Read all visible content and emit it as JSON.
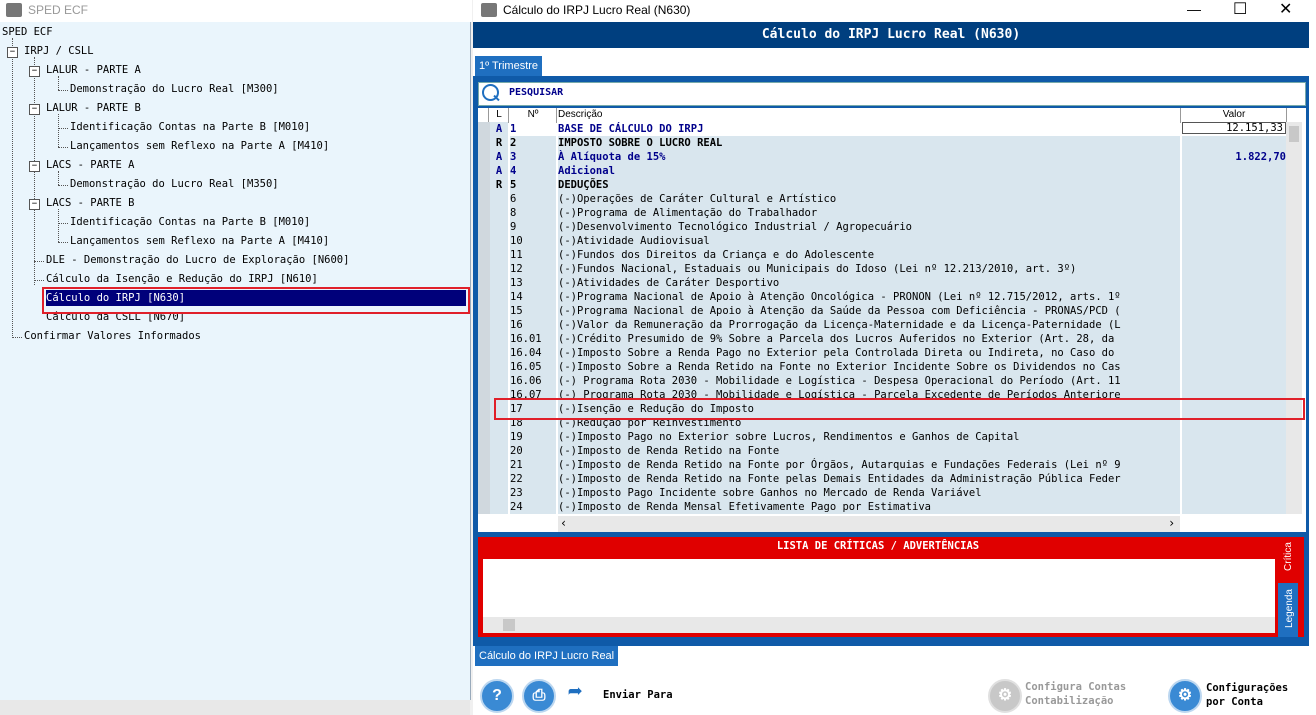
{
  "left_window": {
    "title": "SPED ECF",
    "tree": {
      "root": "SPED ECF",
      "irpj": "IRPJ / CSLL",
      "lalur_a": "LALUR - PARTE A",
      "lalur_a_1": "Demonstração do Lucro Real [M300]",
      "lalur_b": "LALUR - PARTE B",
      "lalur_b_1": "Identificação Contas na Parte B [M010]",
      "lalur_b_2": "Lançamentos sem Reflexo na Parte A [M410]",
      "lacs_a": "LACS - PARTE A",
      "lacs_a_1": "Demonstração do Lucro Real [M350]",
      "lacs_b": "LACS - PARTE B",
      "lacs_b_1": "Identificação Contas na Parte B [M010]",
      "lacs_b_2": "Lançamentos sem Reflexo na Parte A [M410]",
      "dle": "DLE - Demonstração do Lucro de Exploração [N600]",
      "isencao": "Cálculo da Isenção e Redução do IRPJ [N610]",
      "calc_irpj": "Cálculo do IRPJ [N630]",
      "calc_csll": "Cálculo da CSLL [N670]",
      "confirmar": "Confirmar Valores Informados"
    }
  },
  "right_window": {
    "title": "Cálculo do IRPJ Lucro Real (N630)",
    "header": "Cálculo do IRPJ Lucro Real (N630)",
    "tab": "1º Trimestre",
    "search_label": "PESQUISAR",
    "grid_headers": {
      "l": "L",
      "n": "Nº",
      "descricao": "Descrição",
      "valor": "Valor"
    },
    "rows": [
      {
        "flag": "A",
        "n": "1",
        "desc": "BASE DE CÁLCULO DO IRPJ",
        "valor": "12.151,33",
        "style": "bluebold",
        "input": true
      },
      {
        "flag": "R",
        "n": "2",
        "desc": "IMPOSTO SOBRE O LUCRO REAL",
        "valor": "",
        "style": "bold"
      },
      {
        "flag": "A",
        "n": "3",
        "desc": "À Alíquota de 15%",
        "valor": "1.822,70",
        "style": "bluebold"
      },
      {
        "flag": "A",
        "n": "4",
        "desc": "Adicional",
        "valor": "",
        "style": "bluebold"
      },
      {
        "flag": "R",
        "n": "5",
        "desc": "DEDUÇÕES",
        "valor": "",
        "style": "bold"
      },
      {
        "flag": "",
        "n": "6",
        "desc": "(-)Operações de Caráter Cultural e Artístico",
        "valor": ""
      },
      {
        "flag": "",
        "n": "8",
        "desc": "(-)Programa de Alimentação do Trabalhador",
        "valor": ""
      },
      {
        "flag": "",
        "n": "9",
        "desc": "(-)Desenvolvimento Tecnológico Industrial / Agropecuário",
        "valor": ""
      },
      {
        "flag": "",
        "n": "10",
        "desc": "(-)Atividade Audiovisual",
        "valor": ""
      },
      {
        "flag": "",
        "n": "11",
        "desc": "(-)Fundos dos Direitos da Criança e do Adolescente",
        "valor": ""
      },
      {
        "flag": "",
        "n": "12",
        "desc": "(-)Fundos Nacional, Estaduais ou Municipais do Idoso (Lei nº 12.213/2010, art. 3º)",
        "valor": ""
      },
      {
        "flag": "",
        "n": "13",
        "desc": "(-)Atividades de Caráter Desportivo",
        "valor": ""
      },
      {
        "flag": "",
        "n": "14",
        "desc": "(-)Programa Nacional de Apoio à Atenção Oncológica - PRONON (Lei nº 12.715/2012, arts. 1º",
        "valor": ""
      },
      {
        "flag": "",
        "n": "15",
        "desc": "(-)Programa Nacional de Apoio à Atenção da Saúde da Pessoa com Deficiência - PRONAS/PCD (",
        "valor": ""
      },
      {
        "flag": "",
        "n": "16",
        "desc": "(-)Valor da Remuneração da Prorrogação da Licença-Maternidade e da Licença-Paternidade (L",
        "valor": ""
      },
      {
        "flag": "",
        "n": "16.01",
        "desc": "(-)Crédito Presumido de 9% Sobre a Parcela dos Lucros Auferidos no Exterior (Art. 28, da",
        "valor": ""
      },
      {
        "flag": "",
        "n": "16.04",
        "desc": "(-)Imposto Sobre a Renda Pago no Exterior pela Controlada Direta ou Indireta, no Caso do",
        "valor": ""
      },
      {
        "flag": "",
        "n": "16.05",
        "desc": "(-)Imposto Sobre a Renda Retido na Fonte no Exterior Incidente Sobre os Dividendos no Cas",
        "valor": ""
      },
      {
        "flag": "",
        "n": "16.06",
        "desc": "(-) Programa Rota 2030 - Mobilidade e Logística - Despesa Operacional do Período (Art. 11",
        "valor": ""
      },
      {
        "flag": "",
        "n": "16.07",
        "desc": "(-) Programa Rota 2030 - Mobilidade e Logística - Parcela Excedente de Períodos Anteriore",
        "valor": ""
      },
      {
        "flag": "",
        "n": "17",
        "desc": "(-)Isenção e Redução do Imposto",
        "valor": ""
      },
      {
        "flag": "",
        "n": "18",
        "desc": "(-)Redução por Reinvestimento",
        "valor": ""
      },
      {
        "flag": "",
        "n": "19",
        "desc": "(-)Imposto Pago no Exterior sobre Lucros, Rendimentos e Ganhos de Capital",
        "valor": ""
      },
      {
        "flag": "",
        "n": "20",
        "desc": "(-)Imposto de Renda Retido na Fonte",
        "valor": ""
      },
      {
        "flag": "",
        "n": "21",
        "desc": "(-)Imposto de Renda Retido na Fonte por Órgãos, Autarquias e Fundações Federais (Lei nº 9",
        "valor": ""
      },
      {
        "flag": "",
        "n": "22",
        "desc": "(-)Imposto de Renda Retido na Fonte pelas Demais Entidades da Administração Pública Feder",
        "valor": ""
      },
      {
        "flag": "",
        "n": "23",
        "desc": "(-)Imposto Pago Incidente sobre Ganhos no Mercado de Renda Variável",
        "valor": ""
      },
      {
        "flag": "",
        "n": "24",
        "desc": "(-)Imposto de Renda Mensal Efetivamente Pago por Estimativa",
        "valor": ""
      }
    ],
    "critics_title": "LISTA DE CRÍTICAS / ADVERTÊNCIAS",
    "side_tab_critica": "Crítica",
    "side_tab_legenda": "Legenda",
    "bottom_tab": "Cálculo do IRPJ Lucro Real",
    "enviar_para": "Enviar Para",
    "configura_contas_1": "Configura Contas",
    "configura_contas_2": "Contabilização",
    "configuracoes_1": "Configurações",
    "configuracoes_2": "por Conta"
  },
  "colors": {
    "header_blue": "#003f7f",
    "panel_blue": "#0f5aa8",
    "critics_red": "#e00000",
    "selection_navy": "#00007a"
  },
  "icons": [
    "search-icon",
    "help-icon",
    "print-icon",
    "send-arrow-icon",
    "config-accounts-icon",
    "config-per-account-icon",
    "minimize-icon",
    "maximize-icon",
    "close-icon"
  ]
}
